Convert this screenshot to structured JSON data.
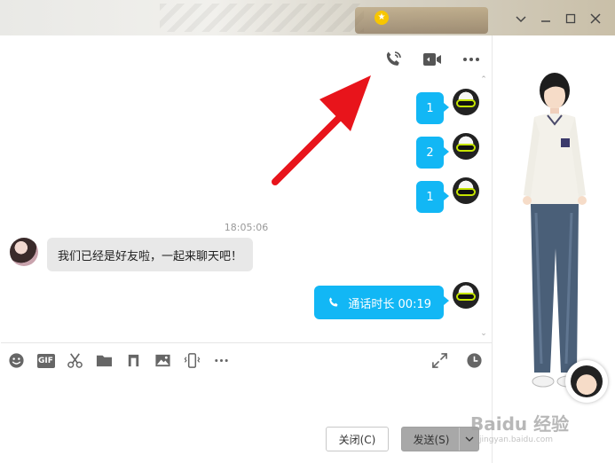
{
  "titlebar": {
    "badge": "★"
  },
  "top_toolbar": {
    "icons": [
      "voice-call-icon",
      "video-call-icon",
      "more-icon"
    ]
  },
  "messages": {
    "sent_1": "1",
    "sent_2": "2",
    "sent_3": "1",
    "timestamp": "18:05:06",
    "received_1": "我们已经是好友啦，一起来聊天吧！",
    "call_record": "通话时长 00:19"
  },
  "input_toolbar": {
    "icons": [
      "emoji-icon",
      "gif-icon",
      "scissors-icon",
      "folder-icon",
      "music-icon",
      "image-icon",
      "shake-icon",
      "more-icon",
      "expand-icon",
      "history-icon"
    ],
    "gif_label": "GIF"
  },
  "input": {
    "value": "",
    "placeholder": ""
  },
  "buttons": {
    "close_label": "关闭(C)",
    "send_label": "发送(S)"
  },
  "watermark": {
    "main": "Baidu 经验",
    "sub": "jingyan.baidu.com"
  },
  "colors": {
    "accent": "#12b7f5",
    "arrow": "#e8141b",
    "icon": "#555555"
  }
}
